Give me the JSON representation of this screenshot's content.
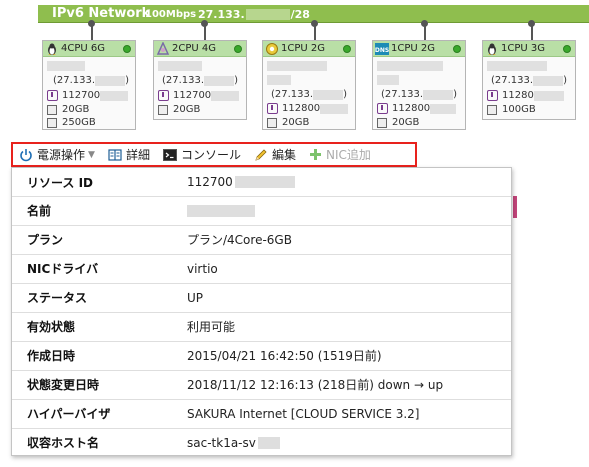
{
  "network": {
    "title": "IPv6 Network",
    "speed": "100Mbps",
    "ip_prefix": "27.133.",
    "ip_suffix": "/28"
  },
  "servers": [
    {
      "spec": "4CPU 6G",
      "ip": "(27.133.",
      "ip_close": ")",
      "id": "112700",
      "disk": "20GB",
      "disk2": "250GB",
      "os_icon": "linux-penguin-icon"
    },
    {
      "spec": "2CPU 4G",
      "ip": "(27.133.",
      "ip_close": ")",
      "id": "112700",
      "disk": "20GB",
      "os_icon": "centos-icon"
    },
    {
      "spec": "1CPU 2G",
      "ip": "(27.133.",
      "ip_close": ")",
      "id": "112800",
      "disk": "20GB",
      "os_icon": "gear-os-icon"
    },
    {
      "spec": "1CPU 2G",
      "ip": "(27.133.",
      "ip_close": ")",
      "id": "112800",
      "disk": "20GB",
      "os_icon": "dns-icon"
    },
    {
      "spec": "1CPU 3G",
      "ip": "(27.133.",
      "ip_close": ")",
      "id": "11280",
      "disk": "100GB",
      "os_icon": "linux-penguin-icon"
    }
  ],
  "toolbar": {
    "power": "電源操作",
    "detail": "詳細",
    "console": "コンソール",
    "edit": "編集",
    "add_nic": "NIC追加"
  },
  "details": [
    {
      "key": "リソース ID",
      "value": "112700"
    },
    {
      "key": "名前",
      "value": ""
    },
    {
      "key": "プラン",
      "value": "プラン/4Core-6GB"
    },
    {
      "key": "NICドライバ",
      "value": "virtio"
    },
    {
      "key": "ステータス",
      "value": "UP"
    },
    {
      "key": "有効状態",
      "value": "利用可能"
    },
    {
      "key": "作成日時",
      "value": "2015/04/21 16:42:50 (1519日前)"
    },
    {
      "key": "状態変更日時",
      "value": "2018/11/12 12:16:13 (218日前) down → up"
    },
    {
      "key": "ハイパーバイザ",
      "value": "SAKURA Internet [CLOUD SERVICE 3.2]"
    },
    {
      "key": "収容ホスト名",
      "value": "sac-tk1a-sv"
    }
  ],
  "colors": {
    "network_bar": "#8fbe4e",
    "card_header": "#b9dfa6",
    "status_led": "#39a82b",
    "toolbar_highlight": "#e8221d",
    "add_nic_icon": "#7cc36b"
  }
}
